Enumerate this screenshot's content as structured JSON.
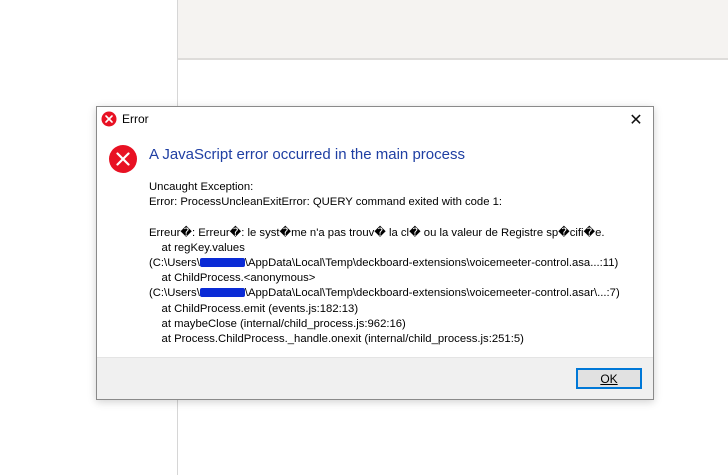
{
  "dialog": {
    "title": "Error",
    "close_glyph": "✕",
    "heading": "A JavaScript error occurred in the main process",
    "message_lines": [
      "Uncaught Exception:",
      "Error: ProcessUncleanExitError: QUERY command exited with code 1:",
      "",
      "Erreur�: Erreur�: le syst�me n'a pas trouv� la cl� ou la valeur de Registre sp�cifi�e.",
      "    at regKey.values",
      "(C:\\Users\\[redacted]\\AppData\\Local\\Temp\\deckboard-extensions\\voicemeeter-control.asa...:11)",
      "    at ChildProcess.<anonymous>",
      "(C:\\Users\\[redacted]\\AppData\\Local\\Temp\\deckboard-extensions\\voicemeeter-control.asar\\...:7)",
      "    at ChildProcess.emit (events.js:182:13)",
      "    at maybeClose (internal/child_process.js:962:16)",
      "    at Process.ChildProcess._handle.onexit (internal/child_process.js:251:5)"
    ],
    "ok_label": "OK",
    "icon": "error-x-icon",
    "colors": {
      "heading": "#1f3fa3",
      "error_icon": "#e81123",
      "ok_border": "#0078d7",
      "redaction": "#0a2bd6"
    }
  }
}
